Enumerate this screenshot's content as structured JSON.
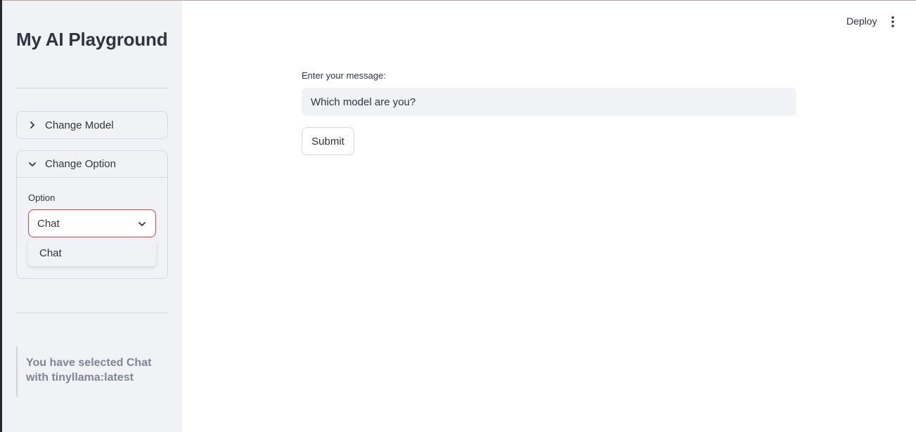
{
  "sidebar": {
    "title": "My AI Playground",
    "expanders": [
      {
        "label": "Change Model",
        "expanded": false,
        "icon": "chevron-right-icon"
      },
      {
        "label": "Change Option",
        "expanded": true,
        "icon": "chevron-down-icon"
      }
    ],
    "option": {
      "label": "Option",
      "selected": "Chat",
      "dropdown_items": [
        "Chat"
      ]
    },
    "info_text": "You have selected Chat with tinyllama:latest"
  },
  "header": {
    "deploy_label": "Deploy",
    "menu_icon": "more-vertical-icon"
  },
  "main": {
    "message_label": "Enter your message:",
    "message_value": "Which model are you?",
    "submit_label": "Submit"
  },
  "colors": {
    "sidebar_bg": "#f0f2f6",
    "text": "#31333f",
    "focus_border": "#e0404a",
    "muted_text": "#808495"
  }
}
